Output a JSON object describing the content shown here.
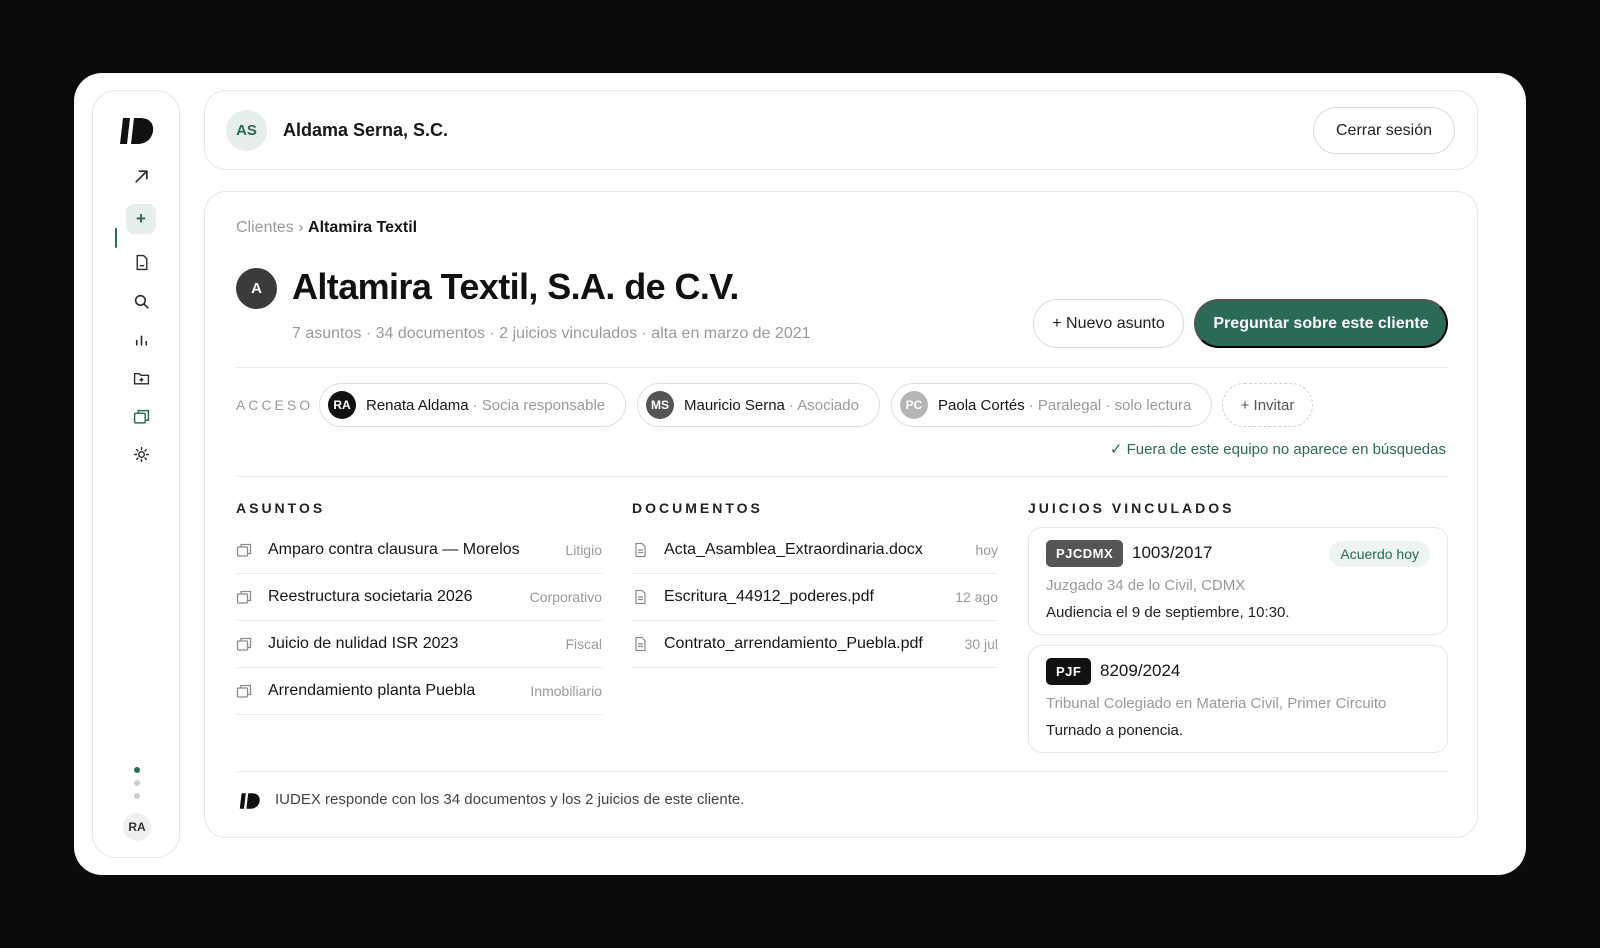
{
  "colors": {
    "accent": "#2b6a58",
    "accent_soft": "#e6efe9",
    "badge_dark": "#111111",
    "badge_gray": "#555555"
  },
  "sidebar": {
    "logo": "iudex-logo",
    "items": [
      {
        "icon": "arrow-up-right-icon"
      },
      {
        "icon": "plus-icon",
        "active": true,
        "label": "+"
      },
      {
        "icon": "document-icon"
      },
      {
        "icon": "search-icon"
      },
      {
        "icon": "bar-chart-icon"
      },
      {
        "icon": "folder-add-icon"
      },
      {
        "icon": "briefcase-icon"
      },
      {
        "icon": "gear-icon"
      }
    ],
    "user_initials": "RA"
  },
  "topbar": {
    "org_initials": "AS",
    "org_name": "Aldama Serna, S.C.",
    "logout_label": "Cerrar sesión"
  },
  "main": {
    "breadcrumb": {
      "parent": "Clientes",
      "sep": " › ",
      "current": "Altamira Textil"
    },
    "client": {
      "initial": "A",
      "name": "Altamira Textil, S.A. de C.V.",
      "meta": "7 asuntos · 34 documentos · 2 juicios vinculados · alta en marzo de 2021"
    },
    "actions": {
      "new_label": "+ Nuevo asunto",
      "ask_label": "Preguntar sobre este cliente"
    },
    "access": {
      "label": "ACCESO",
      "members": [
        {
          "initials": "RA",
          "name": "Renata Aldama",
          "role": "· Socia responsable",
          "color": "#111111"
        },
        {
          "initials": "MS",
          "name": "Mauricio Serna",
          "role": "· Asociado",
          "color": "#555555"
        },
        {
          "initials": "PC",
          "name": "Paola Cortés",
          "role": "· Paralegal · solo lectura",
          "color": "#b5b5b5"
        }
      ],
      "invite_label": "+ Invitar",
      "note": "✓ Fuera de este equipo no aparece en búsquedas"
    },
    "asuntos": {
      "label": "ASUNTOS",
      "items": [
        {
          "title": "Amparo contra clausura — Morelos",
          "tag": "Litigio"
        },
        {
          "title": "Reestructura societaria 2026",
          "tag": "Corporativo"
        },
        {
          "title": "Juicio de nulidad ISR 2023",
          "tag": "Fiscal"
        },
        {
          "title": "Arrendamiento planta Puebla",
          "tag": "Inmobiliario"
        }
      ]
    },
    "documentos": {
      "label": "DOCUMENTOS",
      "items": [
        {
          "name": "Acta_Asamblea_Extraordinaria.docx",
          "date": "hoy"
        },
        {
          "name": "Escritura_44912_poderes.pdf",
          "date": "12 ago"
        },
        {
          "name": "Contrato_arrendamiento_Puebla.pdf",
          "date": "30 jul"
        }
      ]
    },
    "juicios": {
      "label": "JUICIOS VINCULADOS",
      "items": [
        {
          "badge": "PJCDMX",
          "number": "1003/2017",
          "court": "Juzgado 34 de lo Civil, CDMX",
          "detail": "Audiencia el 9 de septiembre, 10:30.",
          "pill": "Acuerdo hoy"
        },
        {
          "badge": "PJF",
          "number": "8209/2024",
          "court": "Tribunal Colegiado en Materia Civil, Primer Circuito",
          "detail": "Turnado a ponencia."
        }
      ]
    },
    "footer": {
      "text": "IUDEX responde con los 34 documentos y los 2 juicios de este cliente."
    }
  }
}
